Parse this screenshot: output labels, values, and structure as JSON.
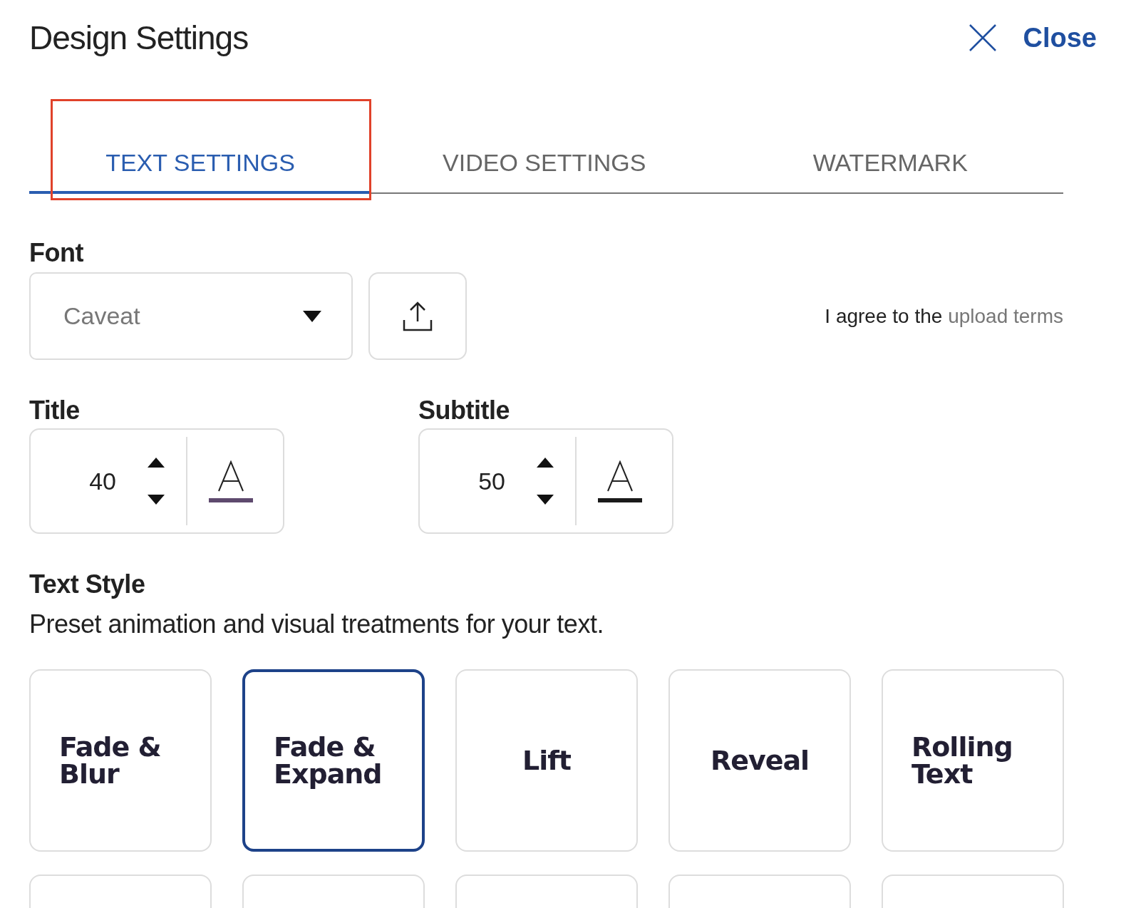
{
  "header": {
    "title": "Design Settings",
    "close_label": "Close"
  },
  "tabs": [
    {
      "label": "TEXT SETTINGS",
      "selected": true,
      "highlighted": true
    },
    {
      "label": "VIDEO SETTINGS",
      "selected": false,
      "highlighted": false
    },
    {
      "label": "WATERMARK",
      "selected": false,
      "highlighted": false
    }
  ],
  "font": {
    "label": "Font",
    "value": "Caveat",
    "terms_text": "I agree to the",
    "terms_link": "upload terms"
  },
  "sizes": [
    {
      "label": "Title",
      "value": "40",
      "color": "#5e4a6e"
    },
    {
      "label": "Subtitle",
      "value": "50",
      "color": "#1a1a1a"
    }
  ],
  "text_style": {
    "label": "Text Style",
    "description": "Preset animation and visual treatments for your text.",
    "presets": [
      {
        "kind": "preset",
        "label": "Fade & Blur",
        "selected": false
      },
      {
        "kind": "preset",
        "label": "Fade & Expand",
        "selected": true
      },
      {
        "kind": "preset",
        "label": "Lift",
        "selected": false
      },
      {
        "kind": "preset",
        "label": "Reveal",
        "selected": false
      },
      {
        "kind": "preset",
        "label": "Rolling Text",
        "selected": false
      },
      {
        "kind": "cut_off",
        "selected": false
      },
      {
        "kind": "cut_off",
        "selected": false
      },
      {
        "kind": "cut_off",
        "selected": false
      },
      {
        "kind": "cut_off",
        "selected": false
      },
      {
        "kind": "cut_off",
        "selected": false
      }
    ]
  }
}
